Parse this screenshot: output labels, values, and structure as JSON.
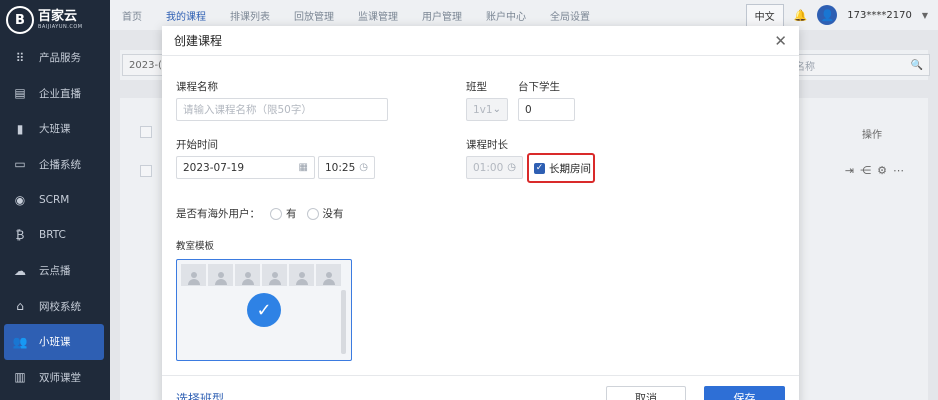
{
  "logo": {
    "mark": "B",
    "title": "百家云",
    "subtitle": "BAIJIAYUN.COM"
  },
  "sidebar": {
    "items": [
      {
        "label": "产品服务",
        "icon": "grid-icon"
      },
      {
        "label": "企业直播",
        "icon": "book-icon"
      },
      {
        "label": "大班课",
        "icon": "notebook-icon"
      },
      {
        "label": "企播系统",
        "icon": "monitor-icon"
      },
      {
        "label": "SCRM",
        "icon": "chat-icon"
      },
      {
        "label": "BRTC",
        "icon": "bitcoin-icon"
      },
      {
        "label": "云点播",
        "icon": "cloud-icon"
      },
      {
        "label": "网校系统",
        "icon": "school-icon"
      },
      {
        "label": "小班课",
        "icon": "group-icon",
        "active": true
      },
      {
        "label": "双师课堂",
        "icon": "open-book-icon"
      }
    ]
  },
  "topnav": {
    "tabs": [
      "首页",
      "我的课程",
      "排课列表",
      "回放管理",
      "监课管理",
      "用户管理",
      "账户中心",
      "全局设置"
    ],
    "active_tab": "我的课程",
    "lang": "中文",
    "user": "173****2170"
  },
  "background": {
    "date_prefix": "2023-(",
    "search_placeholder": "名称",
    "op_header": "操作"
  },
  "modal": {
    "title": "创建课程",
    "course_name_label": "课程名称",
    "course_name_placeholder": "请输入课程名称（限50字）",
    "class_type_label": "班型",
    "class_type_value": "1v1",
    "offline_students_label": "台下学生",
    "offline_students_value": "0",
    "start_time_label": "开始时间",
    "start_date": "2023-07-19",
    "start_time": "10:25",
    "duration_label": "课程时长",
    "duration_value": "01:00",
    "long_term_label": "长期房间",
    "overseas_label": "是否有海外用户：",
    "overseas_yes": "有",
    "overseas_no": "没有",
    "template_label": "教室模板",
    "footer_link": "选择班型",
    "cancel_label": "取消",
    "save_label": "保存"
  }
}
